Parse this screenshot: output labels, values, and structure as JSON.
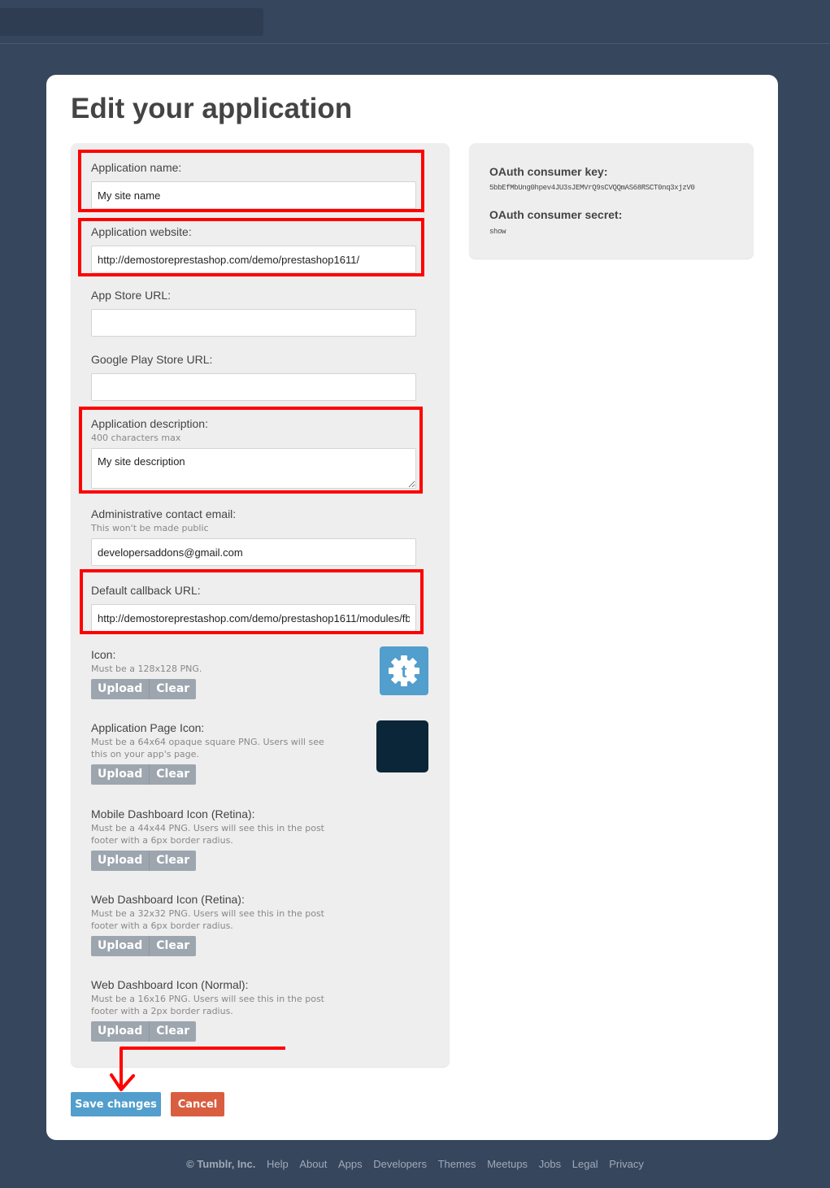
{
  "page": {
    "title": "Edit your application"
  },
  "form": {
    "app_name": {
      "label": "Application name:",
      "value": "My site name"
    },
    "app_website": {
      "label": "Application website:",
      "value": "http://demostoreprestashop.com/demo/prestashop1611/"
    },
    "app_store_url": {
      "label": "App Store URL:",
      "value": ""
    },
    "google_play_url": {
      "label": "Google Play Store URL:",
      "value": ""
    },
    "description": {
      "label": "Application description:",
      "hint": "400 characters max",
      "value": "My site description"
    },
    "admin_email": {
      "label": "Administrative contact email:",
      "hint": "This won't be made public",
      "value": "developersaddons@gmail.com"
    },
    "callback_url": {
      "label": "Default callback URL:",
      "value": "http://demostoreprestashop.com/demo/prestashop1611/modules/fb"
    },
    "icons": [
      {
        "label": "Icon:",
        "hint": "Must be a 128x128 PNG.",
        "upload": "Upload",
        "clear": "Clear"
      },
      {
        "label": "Application Page Icon:",
        "hint": "Must be a 64x64 opaque square PNG. Users will see this on your app's page.",
        "upload": "Upload",
        "clear": "Clear"
      },
      {
        "label": "Mobile Dashboard Icon (Retina):",
        "hint": "Must be a 44x44 PNG. Users will see this in the post footer with a 6px border radius.",
        "upload": "Upload",
        "clear": "Clear"
      },
      {
        "label": "Web Dashboard Icon (Retina):",
        "hint": "Must be a 32x32 PNG. Users will see this in the post footer with a 6px border radius.",
        "upload": "Upload",
        "clear": "Clear"
      },
      {
        "label": "Web Dashboard Icon (Normal):",
        "hint": "Must be a 16x16 PNG. Users will see this in the post footer with a 2px border radius.",
        "upload": "Upload",
        "clear": "Clear"
      }
    ]
  },
  "oauth": {
    "key_label": "OAuth consumer key:",
    "key_value": "5bbEfMbUng0hpev4JU3sJEMVrQ9sCVQQmAS68RSCT0nq3xjzV0",
    "secret_label": "OAuth consumer secret:",
    "secret_value": "show"
  },
  "actions": {
    "save": "Save changes",
    "cancel": "Cancel"
  },
  "footer": {
    "copyright": "© Tumblr, Inc.",
    "links": [
      "Help",
      "About",
      "Apps",
      "Developers",
      "Themes",
      "Meetups",
      "Jobs",
      "Legal",
      "Privacy"
    ]
  },
  "colors": {
    "background": "#36465d",
    "primary": "#529ecc",
    "danger": "#d95e40",
    "annotation": "#ff0000"
  }
}
